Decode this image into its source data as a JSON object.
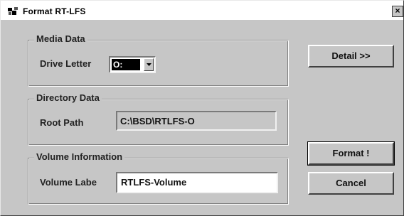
{
  "window": {
    "title": "Format RT-LFS",
    "close_glyph": "×",
    "icon": "app-icon"
  },
  "media": {
    "legend": "Media Data",
    "drive_letter_label": "Drive Letter",
    "drive_letter_value": "O:"
  },
  "directory": {
    "legend": "Directory Data",
    "root_path_label": "Root Path",
    "root_path_value": "C:\\BSD\\RTLFS-O"
  },
  "volume": {
    "legend": "Volume Information",
    "label_label": "Volume Labe",
    "label_value": "RTLFS-Volume"
  },
  "buttons": {
    "detail": "Detail >>",
    "format": "Format !",
    "cancel": "Cancel"
  }
}
